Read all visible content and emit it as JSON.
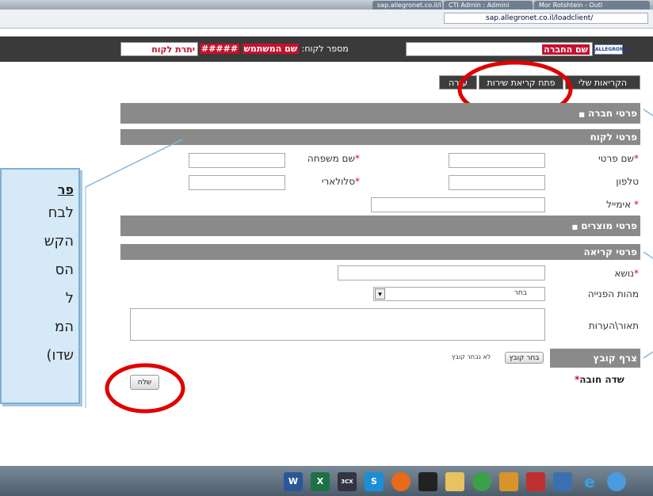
{
  "browser": {
    "tabs": [
      "sap.allegronet.co.il/l",
      "CTI Admin : Admini",
      "Mor Rotshtein - Outl"
    ],
    "url": "sap.allegronet.co.il/loadclient/"
  },
  "header": {
    "company_name_label": "שם החברה",
    "username_label": "שם המשתמש",
    "customer_number_label": "מספר לקוח:",
    "customer_number_value": "#####",
    "customer_balance_label": "יתרת לקוח",
    "logo_text": "ALLEGRONET"
  },
  "menu": {
    "items": [
      "הקריאות שלי",
      "פתח קריאת שירות",
      "עזרה"
    ]
  },
  "sections": {
    "company": "פרטי חברה",
    "customer": "פרטי לקוח",
    "products": "פרטי מוצרים",
    "ticket": "פרטי קריאה",
    "attach": "צרף קובץ"
  },
  "section_bullet": "■",
  "fields": {
    "first_name": "שם פרטי",
    "last_name": "שם משפחה",
    "phone": "טלפון",
    "cell": "סלולארי",
    "email": "אימייל",
    "subject": "נושא",
    "request_type": "מהות הפנייה",
    "description": "תאור\\הערות",
    "required_mark": "*"
  },
  "request_type_select": {
    "selected": "בחר",
    "arrow": "▾"
  },
  "attach": {
    "choose_button": "בחר קובץ",
    "no_file_text": "לא נבחר קובץ"
  },
  "required_note": "שדה חובה",
  "send_button": "שלח",
  "callout": {
    "lines": [
      "פר",
      "לבח",
      "הקש",
      "הס",
      "ל",
      "המ",
      "(שדו"
    ]
  },
  "taskbar_icons": [
    "W",
    "X",
    "3CX",
    "S",
    "",
    "",
    "",
    "",
    "",
    "",
    "e",
    ""
  ],
  "colors": {
    "accent_red": "#c8102e",
    "section_gray": "#8a8a8a",
    "header_dark": "#3a3a3a",
    "callout_blue": "#d6e9f7",
    "annotation_red": "#e00000"
  }
}
